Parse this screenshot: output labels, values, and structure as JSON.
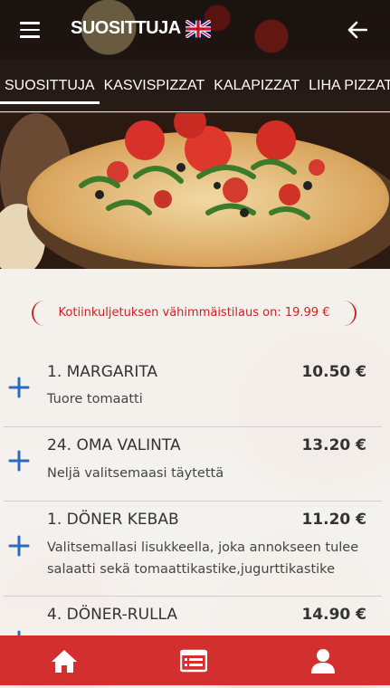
{
  "header": {
    "title": "SUOSITTUJA",
    "language_icon": "uk-flag-icon",
    "menu_icon": "hamburger-menu-icon",
    "back_icon": "back-arrow-icon"
  },
  "tabs": [
    {
      "label": "SUOSITTUJA",
      "active": true
    },
    {
      "label": "KASVISPIZZAT",
      "active": false
    },
    {
      "label": "KALAPIZZAT",
      "active": false
    },
    {
      "label": "LIHA PIZZAT",
      "active": false
    }
  ],
  "notice": "Kotiinkuljetuksen vähimmäistilaus on: 19.99 €",
  "items": [
    {
      "name": "1. MARGARITA",
      "price": "10.50 €",
      "description": "Tuore tomaatti"
    },
    {
      "name": "24. OMA VALINTA",
      "price": "13.20 €",
      "description": "Neljä valitsemaasi täytettä"
    },
    {
      "name": "1. DÖNER KEBAB",
      "price": "11.20 €",
      "description": "Valitsemallasi lisukkeella, joka annokseen tulee salaatti sekä tomaattikastike,jugurttikastike"
    },
    {
      "name": "4. DÖNER-RULLA",
      "price": "14.90 €",
      "description": ""
    }
  ],
  "bottom_nav": [
    {
      "icon": "home-icon"
    },
    {
      "icon": "menu-list-icon"
    },
    {
      "icon": "user-icon"
    }
  ],
  "colors": {
    "accent": "#d32f2f",
    "plus": "#2a6bc0",
    "notice": "#cc2222"
  }
}
